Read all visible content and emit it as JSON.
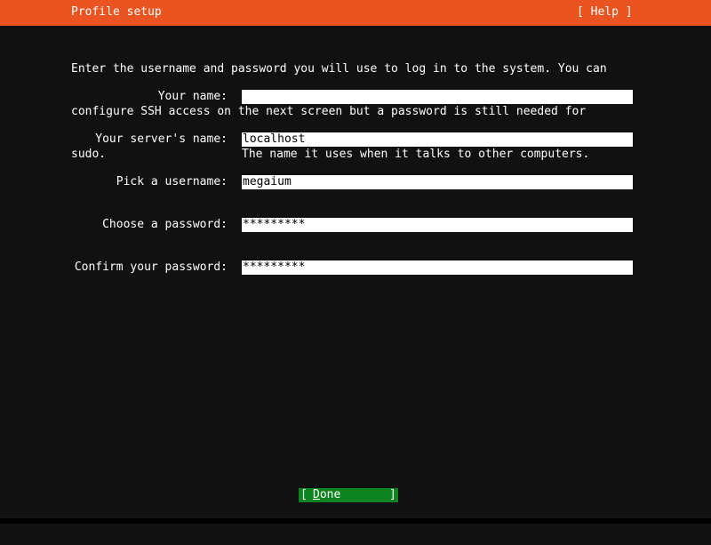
{
  "header": {
    "title": "Profile setup",
    "help_label": "[ Help ]"
  },
  "intro": {
    "lines": [
      "Enter the username and password you will use to log in to the system. You can",
      "configure SSH access on the next screen but a password is still needed for",
      "sudo."
    ]
  },
  "form": {
    "your_name": {
      "label": "Your name:",
      "value": ""
    },
    "server_name": {
      "label": "Your server's name:",
      "value": "localhost",
      "help": "The name it uses when it talks to other computers."
    },
    "username": {
      "label": "Pick a username:",
      "value": "megaium"
    },
    "password": {
      "label": "Choose a password:",
      "value": "*********"
    },
    "confirm_password": {
      "label": "Confirm your password:",
      "value": "*********"
    }
  },
  "footer": {
    "done_open": "[",
    "done_label": "Done",
    "done_close": "]"
  },
  "colors": {
    "header_bg": "#e95420",
    "background": "#111111",
    "done_bg": "#0e8420",
    "input_bg": "#ffffff"
  }
}
